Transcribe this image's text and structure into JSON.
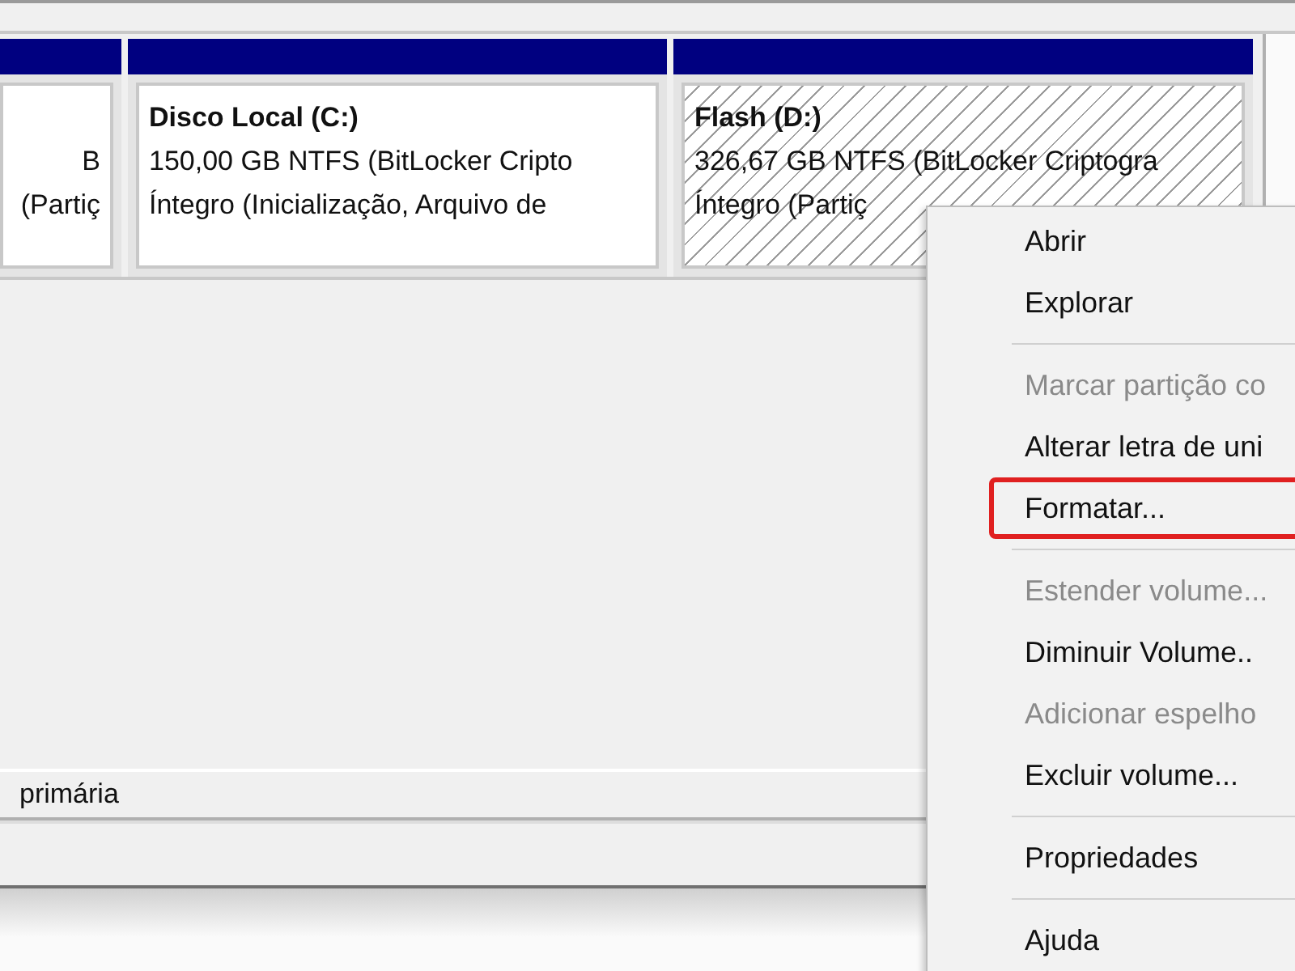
{
  "partitions": [
    {
      "kind": "plain",
      "hatched": false,
      "lines": [
        "B",
        "(Partiç"
      ]
    },
    {
      "kind": "named",
      "hatched": false,
      "name": "Disco Local  (C:)",
      "lines": [
        "150,00 GB NTFS (BitLocker Cripto",
        "Íntegro (Inicialização, Arquivo de"
      ]
    },
    {
      "kind": "named",
      "hatched": true,
      "name": "Flash  (D:)",
      "lines": [
        "326,67 GB NTFS (BitLocker Criptogra",
        "Íntegro (Partiç"
      ]
    }
  ],
  "legend": {
    "text": "primária"
  },
  "context_menu": {
    "items": [
      {
        "kind": "item",
        "label": "Abrir",
        "disabled": false,
        "highlighted": false
      },
      {
        "kind": "item",
        "label": "Explorar",
        "disabled": false,
        "highlighted": false
      },
      {
        "kind": "separator"
      },
      {
        "kind": "item",
        "label": "Marcar partição co",
        "disabled": true,
        "highlighted": false
      },
      {
        "kind": "item",
        "label": "Alterar letra de uni",
        "disabled": false,
        "highlighted": false
      },
      {
        "kind": "item",
        "label": "Formatar...",
        "disabled": false,
        "highlighted": true
      },
      {
        "kind": "separator"
      },
      {
        "kind": "item",
        "label": "Estender volume...",
        "disabled": true,
        "highlighted": false
      },
      {
        "kind": "item",
        "label": "Diminuir Volume..",
        "disabled": false,
        "highlighted": false
      },
      {
        "kind": "item",
        "label": "Adicionar espelho",
        "disabled": true,
        "highlighted": false
      },
      {
        "kind": "item",
        "label": "Excluir volume...",
        "disabled": false,
        "highlighted": false
      },
      {
        "kind": "separator"
      },
      {
        "kind": "item",
        "label": "Propriedades",
        "disabled": false,
        "highlighted": false
      },
      {
        "kind": "separator"
      },
      {
        "kind": "item",
        "label": "Ajuda",
        "disabled": false,
        "highlighted": false
      }
    ]
  }
}
